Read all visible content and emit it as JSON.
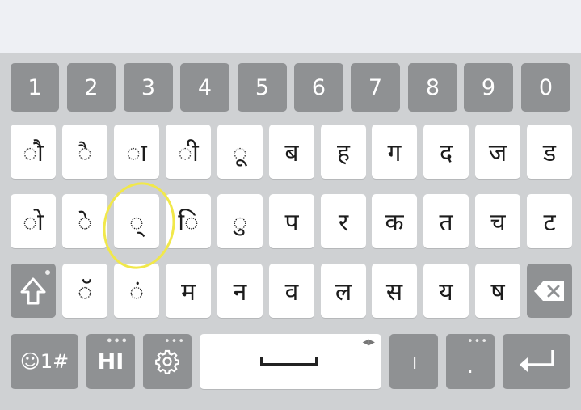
{
  "number_row": [
    "1",
    "2",
    "3",
    "4",
    "5",
    "6",
    "7",
    "8",
    "9",
    "0"
  ],
  "row2": [
    "ौ",
    "ै",
    "ा",
    "ी",
    "ू",
    "ब",
    "ह",
    "ग",
    "द",
    "ज",
    "ड"
  ],
  "row3": [
    "ो",
    "े",
    "्",
    "ि",
    "ु",
    "प",
    "र",
    "क",
    "त",
    "च",
    "ट"
  ],
  "row4": [
    "ॅ",
    "ं",
    "म",
    "न",
    "व",
    "ल",
    "स",
    "य",
    "ष"
  ],
  "bottom": {
    "emoji_label": "☺1#",
    "lang_label": "HI",
    "danda": "।",
    "period": "."
  },
  "icons": {
    "shift": "shift-arrow-icon",
    "backspace": "backspace-icon",
    "settings": "gear-icon",
    "enter": "enter-arrow-icon"
  },
  "colors": {
    "keyboard_bg": "#cfd1d3",
    "white_key": "#ffffff",
    "gray_key": "#8f9193",
    "highlight": "#f1e84a"
  }
}
